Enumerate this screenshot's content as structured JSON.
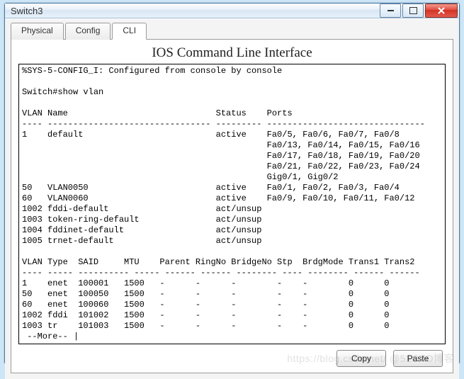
{
  "window": {
    "title": "Switch3"
  },
  "tabs": [
    {
      "label": "Physical",
      "active": false
    },
    {
      "label": "Config",
      "active": false
    },
    {
      "label": "CLI",
      "active": true
    }
  ],
  "panel": {
    "heading": "IOS Command Line Interface"
  },
  "buttons": {
    "copy": "Copy",
    "paste": "Paste"
  },
  "watermark": "https://blog.csdn.net/   @51CTO博客",
  "cli": {
    "syslog": "%SYS-5-CONFIG_I: Configured from console by console",
    "prompt_cmd": "Switch#show vlan",
    "vlan_brief": {
      "cols": [
        "VLAN",
        "Name",
        "Status",
        "Ports"
      ],
      "rows": [
        {
          "id": "1",
          "name": "default",
          "status": "active",
          "ports": [
            "Fa0/5, Fa0/6, Fa0/7, Fa0/8",
            "Fa0/13, Fa0/14, Fa0/15, Fa0/16",
            "Fa0/17, Fa0/18, Fa0/19, Fa0/20",
            "Fa0/21, Fa0/22, Fa0/23, Fa0/24",
            "Gig0/1, Gig0/2"
          ]
        },
        {
          "id": "50",
          "name": "VLAN0050",
          "status": "active",
          "ports": [
            "Fa0/1, Fa0/2, Fa0/3, Fa0/4"
          ]
        },
        {
          "id": "60",
          "name": "VLAN0060",
          "status": "active",
          "ports": [
            "Fa0/9, Fa0/10, Fa0/11, Fa0/12"
          ]
        },
        {
          "id": "1002",
          "name": "fddi-default",
          "status": "act/unsup",
          "ports": []
        },
        {
          "id": "1003",
          "name": "token-ring-default",
          "status": "act/unsup",
          "ports": []
        },
        {
          "id": "1004",
          "name": "fddinet-default",
          "status": "act/unsup",
          "ports": []
        },
        {
          "id": "1005",
          "name": "trnet-default",
          "status": "act/unsup",
          "ports": []
        }
      ]
    },
    "vlan_detail": {
      "cols": [
        "VLAN",
        "Type",
        "SAID",
        "MTU",
        "Parent",
        "RingNo",
        "BridgeNo",
        "Stp",
        "BrdgMode",
        "Trans1",
        "Trans2"
      ],
      "rows": [
        {
          "id": "1",
          "type": "enet",
          "said": "100001",
          "mtu": "1500",
          "parent": "-",
          "ringno": "-",
          "bridgeno": "-",
          "stp": "-",
          "brdgmode": "-",
          "trans1": "0",
          "trans2": "0"
        },
        {
          "id": "50",
          "type": "enet",
          "said": "100050",
          "mtu": "1500",
          "parent": "-",
          "ringno": "-",
          "bridgeno": "-",
          "stp": "-",
          "brdgmode": "-",
          "trans1": "0",
          "trans2": "0"
        },
        {
          "id": "60",
          "type": "enet",
          "said": "100060",
          "mtu": "1500",
          "parent": "-",
          "ringno": "-",
          "bridgeno": "-",
          "stp": "-",
          "brdgmode": "-",
          "trans1": "0",
          "trans2": "0"
        },
        {
          "id": "1002",
          "type": "fddi",
          "said": "101002",
          "mtu": "1500",
          "parent": "-",
          "ringno": "-",
          "bridgeno": "-",
          "stp": "-",
          "brdgmode": "-",
          "trans1": "0",
          "trans2": "0"
        },
        {
          "id": "1003",
          "type": "tr",
          "said": "101003",
          "mtu": "1500",
          "parent": "-",
          "ringno": "-",
          "bridgeno": "-",
          "stp": "-",
          "brdgmode": "-",
          "trans1": "0",
          "trans2": "0"
        }
      ]
    },
    "more_prompt": " --More-- "
  }
}
